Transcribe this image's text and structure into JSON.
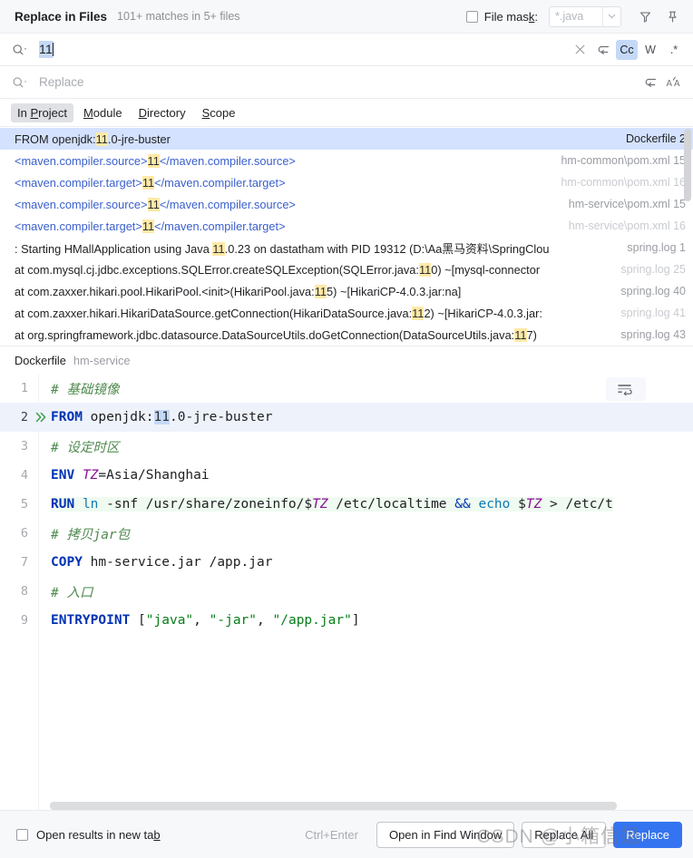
{
  "header": {
    "title": "Replace in Files",
    "matches": "101+ matches in 5+ files",
    "file_mask_label": "File mask:",
    "file_mask_value": "*.java",
    "filter_icon": "filter-funnel-icon",
    "pin_icon": "pin-icon"
  },
  "search": {
    "value": "11",
    "clear_icon": "close-icon",
    "toggles": [
      {
        "name": "new-line-toggle",
        "label": "↩",
        "active": false
      },
      {
        "name": "match-case-toggle",
        "label": "Cc",
        "active": true
      },
      {
        "name": "words-toggle",
        "label": "W",
        "active": false
      },
      {
        "name": "regex-toggle",
        "label": ".*",
        "active": false
      }
    ]
  },
  "replace": {
    "placeholder": "Replace",
    "toggles": [
      {
        "name": "new-line-toggle",
        "label": "↩",
        "active": false
      },
      {
        "name": "preserve-case-toggle",
        "label": "ÁA",
        "active": false
      }
    ]
  },
  "scope_tabs": [
    {
      "label": "In Project",
      "active": true
    },
    {
      "label": "Module",
      "active": false
    },
    {
      "label": "Directory",
      "active": false
    },
    {
      "label": "Scope",
      "active": false
    }
  ],
  "results": [
    {
      "selected": true,
      "dim": false,
      "parts": [
        {
          "t": "FROM openjdk:",
          "s": "plain"
        },
        {
          "t": "11",
          "s": "hl"
        },
        {
          "t": ".0-jre-buster",
          "s": "plain"
        }
      ],
      "file": "Dockerfile 2"
    },
    {
      "selected": false,
      "dim": false,
      "parts": [
        {
          "t": "<maven.compiler.source>",
          "s": "xml-tag"
        },
        {
          "t": "11",
          "s": "hl"
        },
        {
          "t": "</maven.compiler.source>",
          "s": "xml-tag"
        }
      ],
      "file": "hm-common\\pom.xml 15"
    },
    {
      "selected": false,
      "dim": true,
      "parts": [
        {
          "t": "<maven.compiler.target>",
          "s": "xml-tag"
        },
        {
          "t": "11",
          "s": "hl"
        },
        {
          "t": "</maven.compiler.target>",
          "s": "xml-tag"
        }
      ],
      "file": "hm-common\\pom.xml 16"
    },
    {
      "selected": false,
      "dim": false,
      "parts": [
        {
          "t": "<maven.compiler.source>",
          "s": "xml-tag"
        },
        {
          "t": "11",
          "s": "hl"
        },
        {
          "t": "</maven.compiler.source>",
          "s": "xml-tag"
        }
      ],
      "file": "hm-service\\pom.xml 15"
    },
    {
      "selected": false,
      "dim": true,
      "parts": [
        {
          "t": "<maven.compiler.target>",
          "s": "xml-tag"
        },
        {
          "t": "11",
          "s": "hl"
        },
        {
          "t": "</maven.compiler.target>",
          "s": "xml-tag"
        }
      ],
      "file": "hm-service\\pom.xml 16"
    },
    {
      "selected": false,
      "dim": false,
      "parts": [
        {
          "t": " : Starting HMallApplication using Java ",
          "s": "plain"
        },
        {
          "t": "11",
          "s": "hl"
        },
        {
          "t": ".0.23 on dastatham with PID 19312 (D:\\Aa黑马资料\\SpringClou",
          "s": "plain"
        }
      ],
      "file": "spring.log 1"
    },
    {
      "selected": false,
      "dim": true,
      "parts": [
        {
          "t": "at com.mysql.cj.jdbc.exceptions.SQLError.createSQLException(SQLError.java:",
          "s": "plain"
        },
        {
          "t": "11",
          "s": "hl"
        },
        {
          "t": "0) ~[mysql-connector",
          "s": "plain"
        }
      ],
      "file": "spring.log 25"
    },
    {
      "selected": false,
      "dim": false,
      "parts": [
        {
          "t": "at com.zaxxer.hikari.pool.HikariPool.<init>(HikariPool.java:",
          "s": "plain"
        },
        {
          "t": "11",
          "s": "hl"
        },
        {
          "t": "5) ~[HikariCP-4.0.3.jar:na]",
          "s": "plain"
        }
      ],
      "file": "spring.log 40"
    },
    {
      "selected": false,
      "dim": true,
      "parts": [
        {
          "t": "at com.zaxxer.hikari.HikariDataSource.getConnection(HikariDataSource.java:",
          "s": "plain"
        },
        {
          "t": "11",
          "s": "hl"
        },
        {
          "t": "2) ~[HikariCP-4.0.3.jar:",
          "s": "plain"
        }
      ],
      "file": "spring.log 41"
    },
    {
      "selected": false,
      "dim": false,
      "parts": [
        {
          "t": "at org.springframework.jdbc.datasource.DataSourceUtils.doGetConnection(DataSourceUtils.java:",
          "s": "plain"
        },
        {
          "t": "11",
          "s": "hl"
        },
        {
          "t": "7)",
          "s": "plain"
        }
      ],
      "file": "spring.log 43"
    }
  ],
  "preview": {
    "file_name": "Dockerfile",
    "module": "hm-service",
    "wrap_icon": "soft-wrap-icon",
    "run_icon": "docker-run-icon",
    "lines": [
      {
        "num": "1",
        "current": false,
        "run": false,
        "parts": [
          {
            "t": "# 基础镜像",
            "s": "cmt"
          }
        ]
      },
      {
        "num": "2",
        "current": true,
        "run": true,
        "parts": [
          {
            "t": "FROM",
            "s": "kw"
          },
          {
            "t": " openjdk:",
            "s": "txt"
          },
          {
            "t": "11",
            "s": "num-hl"
          },
          {
            "t": ".0",
            "s": "txt"
          },
          {
            "t": "-jre-buster",
            "s": "txt"
          }
        ]
      },
      {
        "num": "3",
        "current": false,
        "run": false,
        "parts": [
          {
            "t": "# 设定时区",
            "s": "cmt"
          }
        ]
      },
      {
        "num": "4",
        "current": false,
        "run": false,
        "parts": [
          {
            "t": "ENV",
            "s": "kw"
          },
          {
            "t": " ",
            "s": "txt"
          },
          {
            "t": "TZ",
            "s": "var"
          },
          {
            "t": "=Asia/Shanghai",
            "s": "txt"
          }
        ]
      },
      {
        "num": "5",
        "current": false,
        "run": false,
        "shell": true,
        "parts": [
          {
            "t": "RUN",
            "s": "kw"
          },
          {
            "t": " ",
            "s": "txt"
          },
          {
            "t": "ln",
            "s": "cmd"
          },
          {
            "t": " -snf /usr/share/zoneinfo/$",
            "s": "txt"
          },
          {
            "t": "TZ",
            "s": "var"
          },
          {
            "t": " /etc/localtime ",
            "s": "txt"
          },
          {
            "t": "&&",
            "s": "kw2"
          },
          {
            "t": " ",
            "s": "txt"
          },
          {
            "t": "echo",
            "s": "cmd"
          },
          {
            "t": " $",
            "s": "txt"
          },
          {
            "t": "TZ",
            "s": "var"
          },
          {
            "t": " > /etc/t",
            "s": "txt"
          }
        ]
      },
      {
        "num": "6",
        "current": false,
        "run": false,
        "parts": [
          {
            "t": "# 拷贝jar包",
            "s": "cmt"
          }
        ]
      },
      {
        "num": "7",
        "current": false,
        "run": false,
        "parts": [
          {
            "t": "COPY",
            "s": "kw"
          },
          {
            "t": " hm-service.jar /app.jar",
            "s": "txt"
          }
        ]
      },
      {
        "num": "8",
        "current": false,
        "run": false,
        "parts": [
          {
            "t": "# 入口",
            "s": "cmt"
          }
        ]
      },
      {
        "num": "9",
        "current": false,
        "run": false,
        "parts": [
          {
            "t": "ENTRYPOINT",
            "s": "kw"
          },
          {
            "t": " [",
            "s": "txt"
          },
          {
            "t": "\"java\"",
            "s": "str"
          },
          {
            "t": ", ",
            "s": "txt"
          },
          {
            "t": "\"-jar\"",
            "s": "str"
          },
          {
            "t": ", ",
            "s": "txt"
          },
          {
            "t": "\"/app.jar\"",
            "s": "str"
          },
          {
            "t": "]",
            "s": "txt"
          }
        ]
      }
    ]
  },
  "footer": {
    "open_new_tab_label": "Open results in new tab",
    "shortcut": "Ctrl+Enter",
    "open_find_window": "Open in Find Window",
    "replace_all": "Replace All",
    "replace": "Replace",
    "watermark": "CSDN @小箱信姐"
  },
  "colors": {
    "accent": "#3574f0",
    "selection": "#d4e2ff",
    "match_highlight": "#ffe9a6",
    "toggle_active": "#c5d9f7"
  }
}
